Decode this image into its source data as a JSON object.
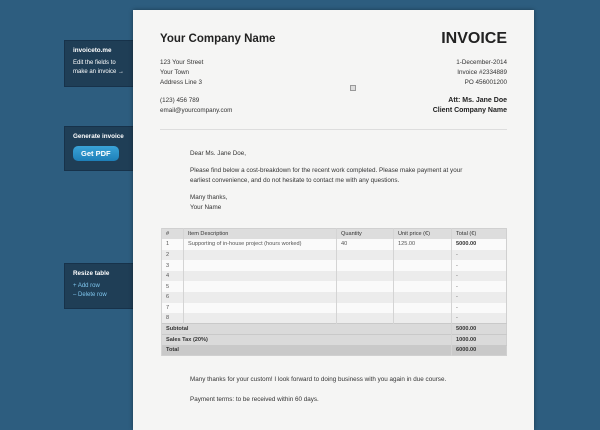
{
  "sidebar": {
    "brand": "invoiceto.me",
    "brand_hint": "Edit the fields to make an invoice →",
    "generate_title": "Generate invoice",
    "get_pdf": "Get PDF",
    "resize_title": "Resize table",
    "add_row": "+  Add row",
    "delete_row": "–  Delete row"
  },
  "company": {
    "name": "Your Company Name",
    "street": "123 Your Street",
    "town": "Your Town",
    "address3": "Address Line 3",
    "phone": "(123) 456 789",
    "email": "email@yourcompany.com"
  },
  "invoice": {
    "title": "INVOICE",
    "date": "1-December-2014",
    "number": "Invoice #2334889",
    "po": "PO 456001200",
    "att": "Att: Ms. Jane Doe",
    "client": "Client Company Name"
  },
  "letter": {
    "greeting": "Dear Ms. Jane Doe,",
    "body": "Please find below a cost-breakdown for the recent work completed. Please make payment at your earliest convenience, and do not hesitate to contact me with any questions.",
    "thanks": "Many thanks,",
    "name": "Your Name"
  },
  "table": {
    "headers": [
      "#",
      "Item Description",
      "Quantity",
      "Unit price (€)",
      "Total (€)"
    ],
    "rows": [
      [
        "1",
        "Supporting of in-house project (hours worked)",
        "40",
        "125.00",
        "5000.00"
      ],
      [
        "2",
        "",
        "",
        "",
        "-"
      ],
      [
        "3",
        "",
        "",
        "",
        "-"
      ],
      [
        "4",
        "",
        "",
        "",
        "-"
      ],
      [
        "5",
        "",
        "",
        "",
        "-"
      ],
      [
        "6",
        "",
        "",
        "",
        "-"
      ],
      [
        "7",
        "",
        "",
        "",
        "-"
      ],
      [
        "8",
        "",
        "",
        "",
        "-"
      ]
    ],
    "subtotal_label": "Subtotal",
    "subtotal": "5000.00",
    "tax_label": "Sales Tax (20%)",
    "tax": "1000.00",
    "total_label": "Total",
    "total": "6000.00"
  },
  "footer": {
    "message": "Many thanks for your custom! I look forward to doing business with you again in due course.",
    "terms": "Payment terms: to be received within 60 days."
  }
}
